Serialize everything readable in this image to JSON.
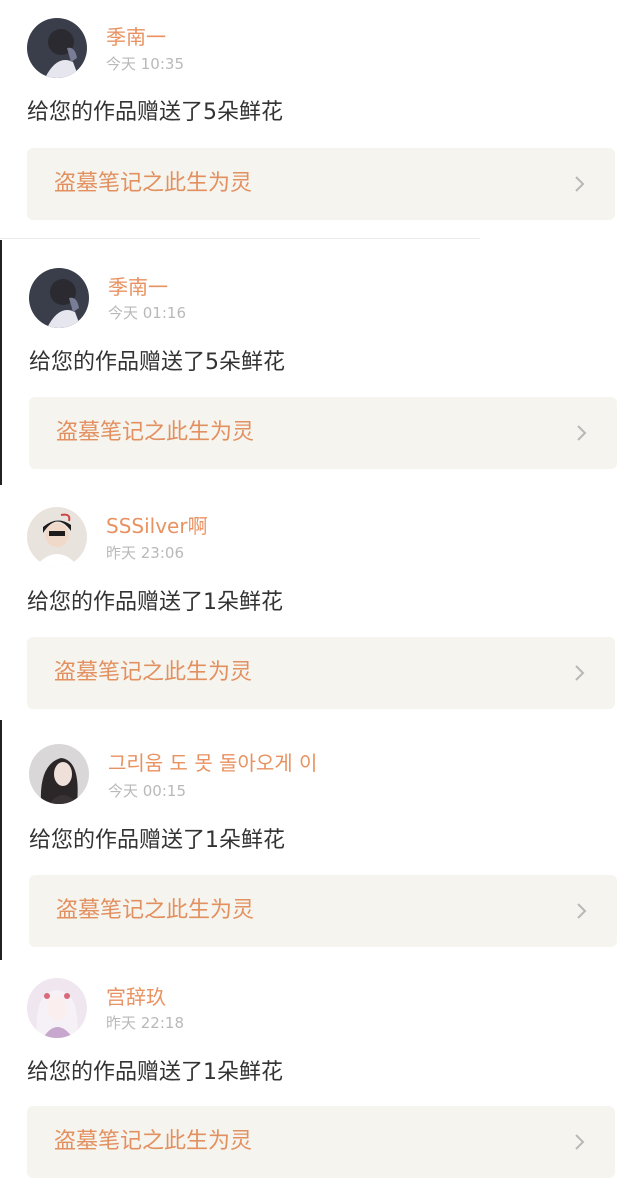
{
  "feed": {
    "items": [
      {
        "username": "季南一",
        "time": "今天 10:35",
        "message": "给您的作品赠送了5朵鲜花",
        "work_title": "盗墓笔记之此生为灵",
        "avatar_icon": "user-avatar"
      },
      {
        "username": "季南一",
        "time": "今天 01:16",
        "message": "给您的作品赠送了5朵鲜花",
        "work_title": "盗墓笔记之此生为灵",
        "avatar_icon": "user-avatar"
      },
      {
        "username": "SSSilver啊",
        "time": "昨天 23:06",
        "message": "给您的作品赠送了1朵鲜花",
        "work_title": "盗墓笔记之此生为灵",
        "avatar_icon": "user-avatar"
      },
      {
        "username": "그리움 도 못 돌아오게 이",
        "time": "今天 00:15",
        "message": "给您的作品赠送了1朵鲜花",
        "work_title": "盗墓笔记之此生为灵",
        "avatar_icon": "user-avatar"
      },
      {
        "username": "宫辞玖",
        "time": "昨天 22:18",
        "message": "给您的作品赠送了1朵鲜花",
        "work_title": "盗墓笔记之此生为灵",
        "avatar_icon": "user-avatar"
      }
    ]
  },
  "colors": {
    "username": "#e99261",
    "card_title": "#e39060",
    "card_bg": "#f6f4ee",
    "time": "#b9b9b9",
    "message": "#333333"
  }
}
